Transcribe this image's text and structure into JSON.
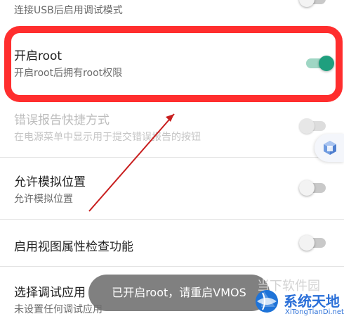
{
  "settings": [
    {
      "title": "",
      "subtitle": "连接USB后启用调试模式",
      "state": "off"
    },
    {
      "title": "开启root",
      "subtitle": "开启root后拥有root权限",
      "state": "on"
    },
    {
      "title": "错误报告快捷方式",
      "subtitle": "在电源菜单中显示用于提交错误报告的按钮",
      "state": "disabled"
    },
    {
      "title": "允许模拟位置",
      "subtitle": "允许模拟位置",
      "state": "off"
    },
    {
      "title": "启用视图属性检查功能",
      "subtitle": "",
      "state": "off"
    },
    {
      "title": "选择调试应用",
      "subtitle": "未设置任何调试应用",
      "state": "none"
    }
  ],
  "toast": "已开启root，请重启VMOS",
  "watermark": {
    "top_text": "当下软件园",
    "brand": "系统天地",
    "url": "XiTongTianDi.net"
  },
  "colors": {
    "accent": "#1f9f7e",
    "highlight": "#ff2e2e",
    "annotation": "#c81e1e"
  },
  "icons": {
    "floating_button": "cube-icon",
    "watermark_logo": "globe-icon"
  }
}
